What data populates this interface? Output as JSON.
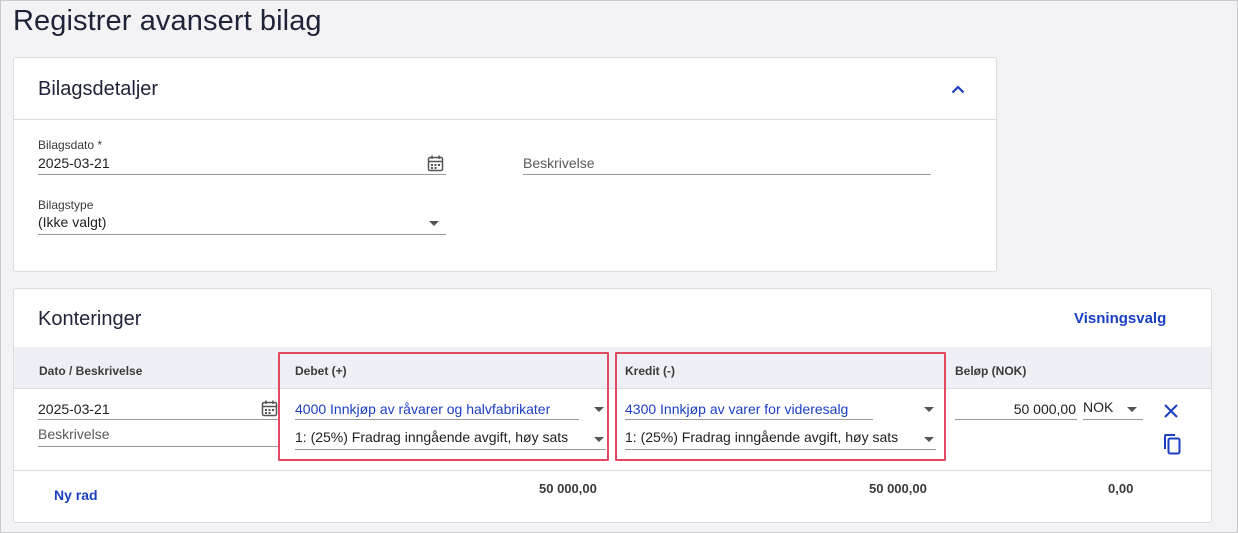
{
  "page": {
    "title": "Registrer avansert bilag"
  },
  "details": {
    "title": "Bilagsdetaljer",
    "date_label": "Bilagsdato *",
    "date_value": "2025-03-21",
    "description_placeholder": "Beskrivelse",
    "type_label": "Bilagstype",
    "type_value": "(Ikke valgt)"
  },
  "postings": {
    "title": "Konteringer",
    "view_options": "Visningsvalg",
    "columns": {
      "date_desc": "Dato / Beskrivelse",
      "debit": "Debet (+)",
      "credit": "Kredit (-)",
      "amount": "Beløp (NOK)"
    },
    "rows": [
      {
        "date": "2025-03-21",
        "description_placeholder": "Beskrivelse",
        "debit_account": "4000 Innkjøp av råvarer og halvfabrikater",
        "debit_vat": "1: (25%) Fradrag inngående avgift, høy sats",
        "credit_account": "4300 Innkjøp av varer for videresalg",
        "credit_vat": "1: (25%) Fradrag inngående avgift, høy sats",
        "amount": "50 000,00",
        "currency": "NOK"
      }
    ],
    "new_row": "Ny rad",
    "totals": {
      "debit": "50 000,00",
      "credit": "50 000,00",
      "amount": "0,00"
    }
  },
  "colors": {
    "accent": "#1b3fc2",
    "highlight": "#e0495f"
  }
}
